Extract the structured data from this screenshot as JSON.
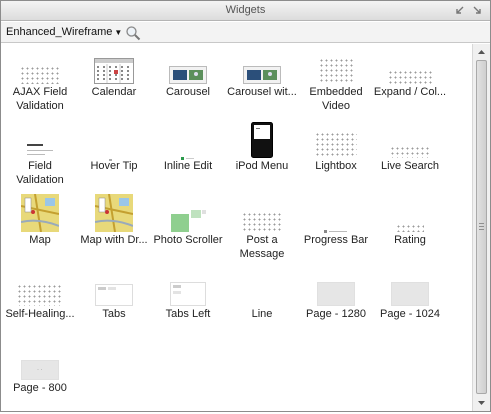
{
  "window": {
    "title": "Widgets"
  },
  "toolbar": {
    "library": "Enhanced_Wireframe"
  },
  "icons": {
    "minimize": "minimize-arrow-icon",
    "pin": "pin-icon",
    "dropdown": "triangle-down-icon",
    "search": "search-icon",
    "scroll_up": "scroll-up-arrow-icon",
    "scroll_down": "scroll-down-arrow-icon"
  },
  "colors": {
    "title_bg": "#dcdcdc",
    "panel_border": "#8c8c8c",
    "map_yellow": "#e8d97a",
    "photo_green": "#8fcf8f"
  },
  "widgets": [
    {
      "label": "AJAX Field",
      "label2": "Validation",
      "thumb": "dots"
    },
    {
      "label": "Calendar",
      "label2": "",
      "thumb": "calendar"
    },
    {
      "label": "Carousel",
      "label2": "",
      "thumb": "carousel"
    },
    {
      "label": "Carousel wit...",
      "label2": "",
      "thumb": "carousel"
    },
    {
      "label": "Embedded",
      "label2": "Video",
      "thumb": "video"
    },
    {
      "label": "Expand / Col...",
      "label2": "",
      "thumb": "expand"
    },
    {
      "label": "Field",
      "label2": "Validation",
      "thumb": "field"
    },
    {
      "label": "Hover Tip",
      "label2": "",
      "thumb": "tiny"
    },
    {
      "label": "Inline Edit",
      "label2": "",
      "thumb": "inline"
    },
    {
      "label": "iPod Menu",
      "label2": "",
      "thumb": "ipod"
    },
    {
      "label": "Lightbox",
      "label2": "",
      "thumb": "lightbox"
    },
    {
      "label": "Live Search",
      "label2": "",
      "thumb": "livesearch"
    },
    {
      "label": "Map",
      "label2": "",
      "thumb": "map"
    },
    {
      "label": "Map with Dr...",
      "label2": "",
      "thumb": "map"
    },
    {
      "label": "Photo Scroller",
      "label2": "",
      "thumb": "photo"
    },
    {
      "label": "Post a",
      "label2": "Message",
      "thumb": "post"
    },
    {
      "label": "Progress Bar",
      "label2": "",
      "thumb": "progress"
    },
    {
      "label": "Rating",
      "label2": "",
      "thumb": "rating"
    },
    {
      "label": "Self-Healing...",
      "label2": "",
      "thumb": "selfheal"
    },
    {
      "label": "Tabs",
      "label2": "",
      "thumb": "tabs"
    },
    {
      "label": "Tabs Left",
      "label2": "",
      "thumb": "tabsleft"
    },
    {
      "label": "Line",
      "label2": "",
      "thumb": "none"
    },
    {
      "label": "Page - 1280",
      "label2": "",
      "thumb": "page"
    },
    {
      "label": "Page - 1024",
      "label2": "",
      "thumb": "page"
    },
    {
      "label": "Page - 800",
      "label2": "",
      "thumb": "page800"
    }
  ]
}
